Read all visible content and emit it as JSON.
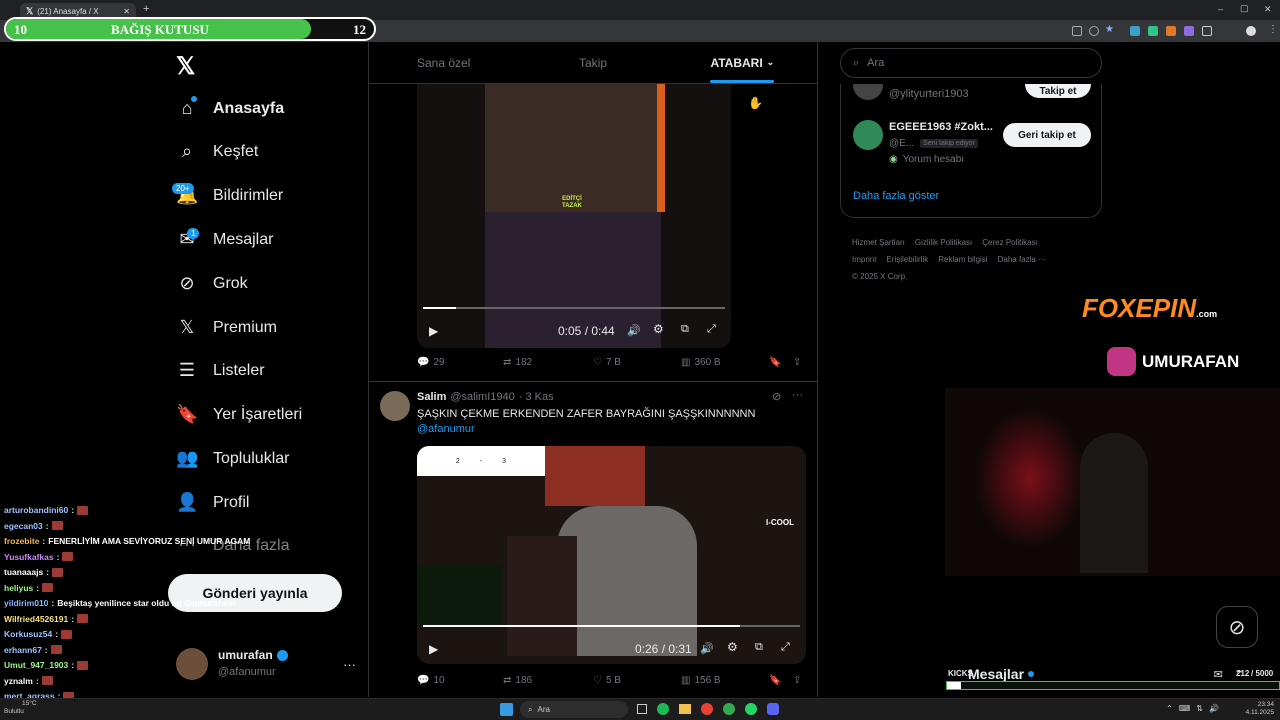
{
  "browser": {
    "tab_title": "(21) Anasayfa / X",
    "new_tab_symbol": "+",
    "window_controls": [
      "–",
      "▢",
      "✕"
    ]
  },
  "donation": {
    "title": "BAĞIŞ KUTUSU",
    "current": "10",
    "goal": "12",
    "progress": 0.83
  },
  "nav": {
    "items": [
      {
        "label": "Anasayfa",
        "icon": "home-icon"
      },
      {
        "label": "Keşfet",
        "icon": "search-icon"
      },
      {
        "label": "Bildirimler",
        "icon": "bell-icon",
        "badge": "20+"
      },
      {
        "label": "Mesajlar",
        "icon": "mail-icon",
        "badge": "1"
      },
      {
        "label": "Grok",
        "icon": "grok-icon"
      },
      {
        "label": "Premium",
        "icon": "x-logo-icon"
      },
      {
        "label": "Listeler",
        "icon": "list-icon"
      },
      {
        "label": "Yer İşaretleri",
        "icon": "bookmark-icon"
      },
      {
        "label": "Topluluklar",
        "icon": "communities-icon"
      },
      {
        "label": "Profil",
        "icon": "profile-icon"
      },
      {
        "label": "Daha fazla",
        "icon": "more-circle-icon"
      }
    ],
    "post_button": "Gönderi yayınla",
    "account": {
      "name": "umurafan",
      "handle": "@afanumur"
    }
  },
  "feed": {
    "tabs": [
      "Sana özel",
      "Takip",
      "ATABARI"
    ],
    "post1": {
      "video_overlay": "EDİTÇİ\nTAZAK",
      "time": "0:05 / 0:44",
      "replies": "29",
      "reposts": "182",
      "likes": "7 B",
      "views": "360 B",
      "progress": 0.11
    },
    "post2": {
      "name": "Salim",
      "handle": "@salimI1940",
      "date": "· 3 Kas",
      "text": "ŞAŞKIN ÇEKME ERKENDEN ZAFER BAYRAĞINI ŞAŞŞKINNNNNN",
      "mention": "@afanumur",
      "scoreboard": {
        "home": "2",
        "sep": "-",
        "away": "3"
      },
      "ad_text": "I-COOL",
      "time": "0:26 / 0:31",
      "replies": "10",
      "reposts": "186",
      "likes": "5 B",
      "views": "156 B",
      "progress": 0.84
    }
  },
  "right": {
    "search_placeholder": "Ara",
    "follow1": {
      "handle": "@ylityurteri1903",
      "button": "Takip et"
    },
    "follow2": {
      "name": "EGEEE1963 #Zokt...",
      "handle": "@E...",
      "follows_you": "Seni takip ediyor",
      "note": "Yorum hesabı",
      "button": "Geri takip et"
    },
    "show_more": "Daha fazla göster",
    "footer": [
      "Hizmet Şartları",
      "Gizlilik Politikası",
      "Çerez Politikası",
      "Imprint",
      "Erişilebilirlik",
      "Reklam bilgisi",
      "Daha fazla ···",
      "© 2025 X Corp."
    ]
  },
  "overlay": {
    "sponsor": "FOXEPIN",
    "sponsor_domain": ".com",
    "instagram": "UMURAFAN",
    "kicks_label": "KICKS",
    "kicks_count": "212",
    "kicks_goal": "/ 5000",
    "messages_label": "Mesajlar"
  },
  "chat": [
    {
      "user": "arturobandini60",
      "color": "#9ec3ff",
      "msg": ""
    },
    {
      "user": "egecan03",
      "color": "#9ec3ff",
      "msg": ""
    },
    {
      "user": "frozebite",
      "color": "#f0b44a",
      "msg": "FENERLİYİM AMA SEVİYORUZ SENİ UMUR AGAM"
    },
    {
      "user": "Yusufkafkas",
      "color": "#c48cf0",
      "msg": ""
    },
    {
      "user": "tuanaaajs",
      "color": "#ffffff",
      "msg": ""
    },
    {
      "user": "heliyus",
      "color": "#9ef58a",
      "msg": ""
    },
    {
      "user": "yildirim010",
      "color": "#8ab4ff",
      "msg": "Beşiktaş yenilince star oldu aq @umurafann"
    },
    {
      "user": "Wilfried4526191",
      "color": "#f5e07a",
      "msg": ""
    },
    {
      "user": "Korkusuz54",
      "color": "#9ec3ff",
      "msg": ""
    },
    {
      "user": "erhann67",
      "color": "#9ec3ff",
      "msg": ""
    },
    {
      "user": "Umut_947_1903",
      "color": "#9ef58a",
      "msg": ""
    },
    {
      "user": "yznalm",
      "color": "#ffffff",
      "msg": ""
    },
    {
      "user": "mert_agrass",
      "color": "#9ec3ff",
      "msg": ""
    }
  ],
  "taskbar": {
    "weather_temp": "15°C",
    "weather_desc": "Bulutlu",
    "search": "Ara",
    "time": "23:34",
    "date": "4.11.2025"
  }
}
